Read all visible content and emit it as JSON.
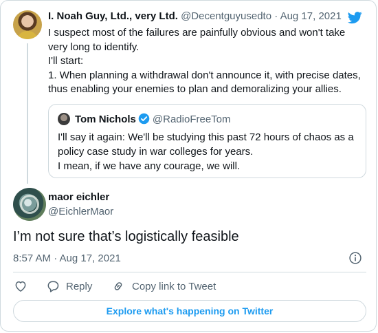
{
  "parent_tweet": {
    "name": "I. Noah Guy, Ltd., very Ltd.",
    "handle": "@Decentguyusedto",
    "separator": "·",
    "date": "Aug 17, 2021",
    "lines": [
      "I suspect most of the failures are painfully obvious and won't take",
      "very long to identify.",
      "I'll start:",
      "1. When planning a withdrawal don't announce it, with precise dates,",
      "thus enabling your enemies to plan and demoralizing your allies."
    ]
  },
  "quoted_tweet": {
    "name": "Tom Nichols",
    "handle": "@RadioFreeTom",
    "lines": [
      "I'll say it again: We'll be studying this past 72 hours of chaos as a",
      "policy case study in war colleges for years.",
      "I mean, if we have any courage, we will."
    ]
  },
  "main_tweet": {
    "name": "maor eichler",
    "handle": "@EichlerMaor",
    "text": "I’m not sure that’s logistically feasible",
    "timestamp": "8:57 AM · Aug 17, 2021"
  },
  "actions": {
    "reply_label": "Reply",
    "copy_link_label": "Copy link to Tweet"
  },
  "explore_label": "Explore what's happening on Twitter",
  "icons": {
    "brand": "twitter-bird-icon",
    "verified": "verified-badge-icon",
    "info": "info-icon",
    "like": "heart-icon",
    "reply": "reply-bubble-icon",
    "copy_link": "link-icon"
  },
  "colors": {
    "brand_blue": "#1d9bf0",
    "text_primary": "#0f1419",
    "text_secondary": "#536471",
    "border": "#cfd9de"
  }
}
